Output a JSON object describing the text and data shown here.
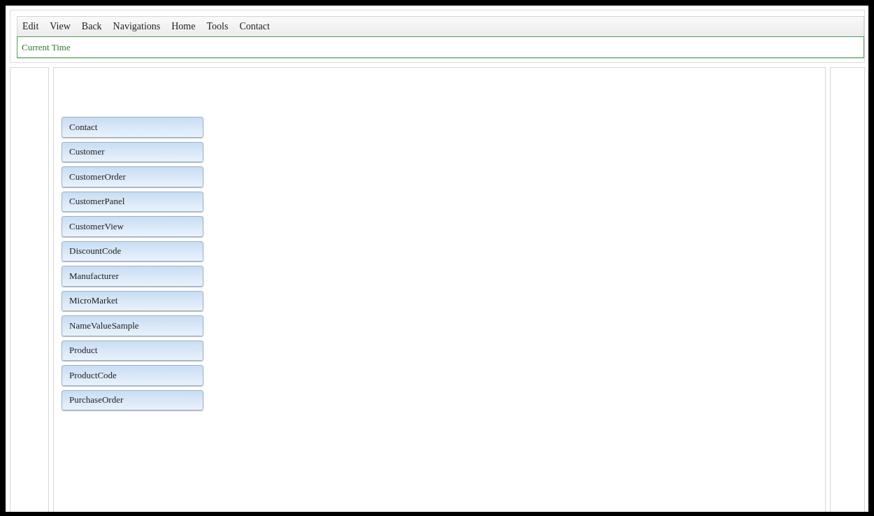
{
  "menu": [
    "Edit",
    "View",
    "Back",
    "Navigations",
    "Home",
    "Tools",
    "Contact"
  ],
  "status": "Current Time",
  "buttons": [
    "Contact",
    "Customer",
    "CustomerOrder",
    "CustomerPanel",
    "CustomerView",
    "DiscountCode",
    "Manufacturer",
    "MicroMarket",
    "NameValueSample",
    "Product",
    "ProductCode",
    "PurchaseOrder"
  ]
}
